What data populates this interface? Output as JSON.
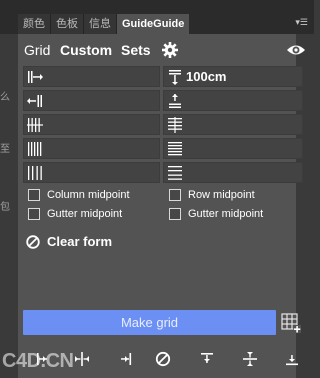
{
  "tabs": [
    "颜色",
    "色板",
    "信息",
    "GuideGuide"
  ],
  "panel_menu_icon": "panel-menu-icon",
  "nav": {
    "grid": "Grid",
    "custom": "Custom",
    "sets": "Sets",
    "settings_icon": "gear-icon",
    "visibility_icon": "eye-icon"
  },
  "fields": {
    "left": [
      {
        "icon": "margin-left-icon",
        "value": ""
      },
      {
        "icon": "margin-right-icon",
        "value": ""
      },
      {
        "icon": "columns-icon",
        "value": ""
      },
      {
        "icon": "column-width-icon",
        "value": ""
      },
      {
        "icon": "column-gutter-icon",
        "value": ""
      }
    ],
    "right": [
      {
        "icon": "margin-top-icon",
        "value": "100cm"
      },
      {
        "icon": "margin-bottom-icon",
        "value": ""
      },
      {
        "icon": "rows-icon",
        "value": ""
      },
      {
        "icon": "row-height-icon",
        "value": ""
      },
      {
        "icon": "row-gutter-icon",
        "value": ""
      }
    ]
  },
  "options": {
    "column_midpoint": "Column midpoint",
    "row_midpoint": "Row midpoint",
    "gutter_midpoint_left": "Gutter midpoint",
    "gutter_midpoint_right": "Gutter midpoint"
  },
  "clear_form": "Clear form",
  "make_grid": "Make grid",
  "watermark": "C4D.CN",
  "left_edge_chars": [
    "么",
    "至",
    "包"
  ],
  "colors": {
    "accent": "#6b8ff3",
    "panel": "#535353",
    "field": "#434343",
    "chrome": "#2b2b2b"
  }
}
